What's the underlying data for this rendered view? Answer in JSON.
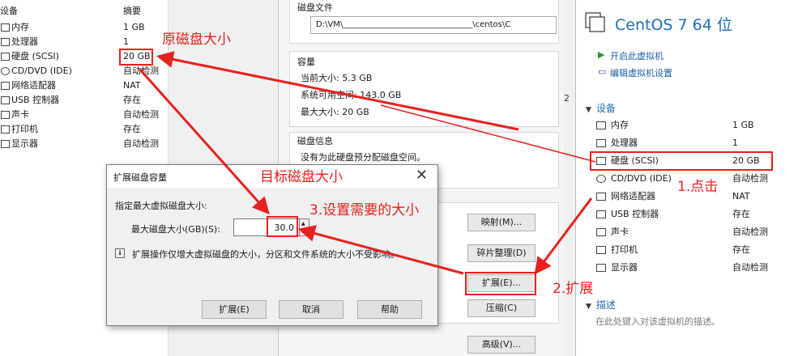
{
  "left_list": {
    "header_name": "设备",
    "header_value": "摘要",
    "items": [
      {
        "name": "内存",
        "value": "1 GB",
        "icon": "memory-icon"
      },
      {
        "name": "处理器",
        "value": "1",
        "icon": "cpu-icon"
      },
      {
        "name": "硬盘 (SCSI)",
        "value": "20 GB",
        "icon": "disk-icon"
      },
      {
        "name": "CD/DVD (IDE)",
        "value": "自动检测",
        "icon": "cd-icon"
      },
      {
        "name": "网络适配器",
        "value": "NAT",
        "icon": "network-icon"
      },
      {
        "name": "USB 控制器",
        "value": "存在",
        "icon": "usb-icon"
      },
      {
        "name": "声卡",
        "value": "自动检测",
        "icon": "sound-icon"
      },
      {
        "name": "打印机",
        "value": "存在",
        "icon": "printer-icon"
      },
      {
        "name": "显示器",
        "value": "自动检测",
        "icon": "display-icon"
      }
    ]
  },
  "detail": {
    "file_label": "磁盘文件",
    "file_path": "D:\\VM\\________________________________\\centos\\C",
    "capacity_label": "容量",
    "current_size": "当前大小: 5.3 GB",
    "system_free": "系统可用空间: 143.0 GB",
    "max_size": "最大大小: 20 GB",
    "info_label": "磁盘信息",
    "info_text": "没有为此硬盘预分配磁盘空间。",
    "buttons": {
      "map": "映射(M)...",
      "defrag": "碎片整理(D)",
      "expand": "扩展(E)...",
      "compact": "压缩(C)",
      "advanced": "高级(V)..."
    },
    "side_number": "2"
  },
  "summary": {
    "title": "CentOS 7 64 位",
    "power_on": "开启此虚拟机",
    "edit_settings": "编辑虚拟机设置",
    "devices_section": "设备",
    "devices": [
      {
        "name": "内存",
        "value": "1 GB",
        "icon": "memory-icon"
      },
      {
        "name": "处理器",
        "value": "1",
        "icon": "cpu-icon"
      },
      {
        "name": "硬盘 (SCSI)",
        "value": "20 GB",
        "icon": "disk-icon"
      },
      {
        "name": "CD/DVD (IDE)",
        "value": "自动检测",
        "icon": "cd-icon"
      },
      {
        "name": "网络适配器",
        "value": "NAT",
        "icon": "network-icon"
      },
      {
        "name": "USB 控制器",
        "value": "存在",
        "icon": "usb-icon"
      },
      {
        "name": "声卡",
        "value": "自动检测",
        "icon": "sound-icon"
      },
      {
        "name": "打印机",
        "value": "存在",
        "icon": "printer-icon"
      },
      {
        "name": "显示器",
        "value": "自动检测",
        "icon": "display-icon"
      }
    ],
    "description_section": "描述",
    "description_placeholder": "在此处键入对该虚拟机的描述。"
  },
  "dialog": {
    "title": "扩展磁盘容量",
    "close": "✕",
    "label": "指定最大虚拟磁盘大小:",
    "size_label": "最大磁盘大小(GB)(S):",
    "size_value": "30.0",
    "note": "扩展操作仅增大虚拟磁盘的大小，分区和文件系统的大小不受影响。",
    "buttons": {
      "expand": "扩展(E)",
      "cancel": "取消",
      "help": "帮助"
    }
  },
  "annotations": {
    "original_size": "原磁盘大小",
    "target_size": "目标磁盘大小",
    "step3": "3.设置需要的大小",
    "step1": "1.点击",
    "step2": "2.扩展"
  },
  "colors": {
    "annotation": "#e8201e",
    "accent": "#1d6fb8",
    "play": "#2a9a2a"
  }
}
